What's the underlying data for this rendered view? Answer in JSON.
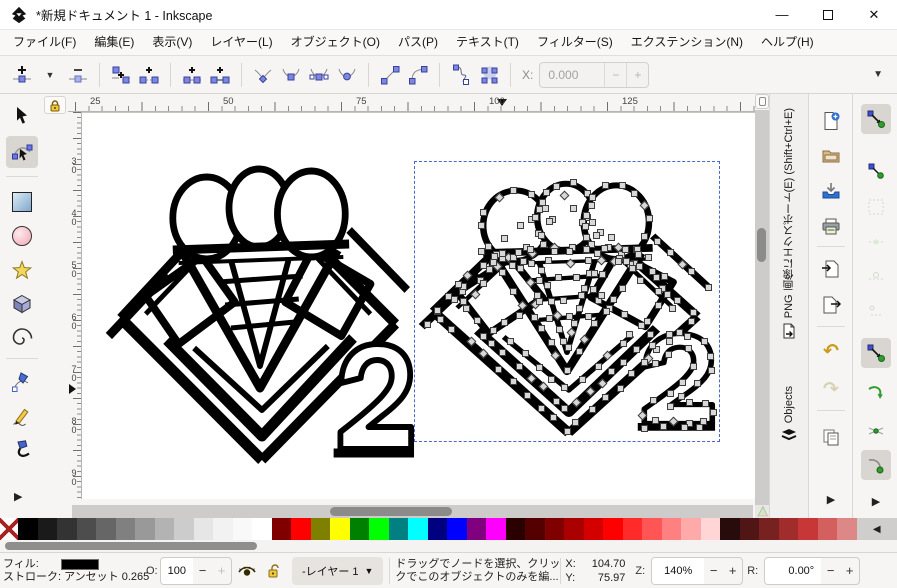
{
  "window": {
    "title": "*新規ドキュメント 1 - Inkscape",
    "minimize_glyph": "—",
    "close_glyph": "✕"
  },
  "menubar": {
    "items": [
      {
        "label": "ファイル(F)"
      },
      {
        "label": "編集(E)"
      },
      {
        "label": "表示(V)"
      },
      {
        "label": "レイヤー(L)"
      },
      {
        "label": "オブジェクト(O)"
      },
      {
        "label": "パス(P)"
      },
      {
        "label": "テキスト(T)"
      },
      {
        "label": "フィルター(S)"
      },
      {
        "label": "エクステンション(N)"
      },
      {
        "label": "ヘルプ(H)"
      }
    ]
  },
  "tool_options": {
    "icons": [
      "insert-node",
      "node-menu-dropdown",
      "delete-node",
      "break-node",
      "delete-segment",
      "join-nodes",
      "join-segment",
      "node-corner",
      "node-smooth",
      "node-symmetric",
      "node-auto",
      "segment-line",
      "segment-curve",
      "path-outline",
      "show-transform-handles"
    ],
    "x_label": "X:",
    "x_value": "0.000",
    "minus": "−",
    "plus": "+",
    "overflow_glyph": "▼"
  },
  "toolbox": {
    "tools": [
      "selector",
      "node-editor",
      "rectangle",
      "ellipse",
      "star",
      "box-3d",
      "spiral",
      "pen",
      "pencil",
      "calligraphy"
    ],
    "active_tool": "node-editor",
    "expander_glyph": "▶"
  },
  "rulers": {
    "horizontal_labels": [
      "25",
      "50",
      "75",
      "100",
      "125"
    ],
    "vertical_labels": [
      "30",
      "40",
      "50",
      "60",
      "70",
      "80",
      "90"
    ]
  },
  "dock_tabs": {
    "export_label": "PNG 画像にエクスポート(E) (Shift+Ctrl+E)",
    "objects_label": "Objects"
  },
  "commands_bar": {
    "icons": [
      "new-document",
      "open-document",
      "save-document",
      "print",
      "import",
      "export",
      "undo",
      "redo",
      "duplicate",
      "more"
    ],
    "undo_glyph": "↶",
    "redo_glyph": "↷",
    "expander_glyph": "▶"
  },
  "snap_bar": {
    "icons": [
      "snap-enabled",
      "snap-bounding-box",
      "snap-bbox-edges",
      "snap-bbox-corners",
      "snap-bbox-midpoints",
      "snap-bbox-centers",
      "snap-nodes",
      "snap-to-paths",
      "snap-path-intersections",
      "snap-smooth-nodes",
      "more"
    ],
    "expander_glyph": "▶"
  },
  "palette": {
    "prev_glyph": "◀",
    "colors": [
      "none",
      "#000000",
      "#1a1a1a",
      "#333333",
      "#4d4d4d",
      "#666666",
      "#808080",
      "#999999",
      "#b3b3b3",
      "#cccccc",
      "#e6e6e6",
      "#f2f2f2",
      "#f9f9f9",
      "#ffffff",
      "#800000",
      "#ff0000",
      "#808000",
      "#ffff00",
      "#008000",
      "#00ff00",
      "#008080",
      "#00ffff",
      "#000080",
      "#0000ff",
      "#800080",
      "#ff00ff",
      "#2b0000",
      "#550000",
      "#800000",
      "#aa0000",
      "#d40000",
      "#ff0000",
      "#ff2a2a",
      "#ff5555",
      "#ff8080",
      "#ffaaaa",
      "#ffd5d5",
      "#280b0b",
      "#501616",
      "#782121",
      "#a02c2c",
      "#c83737",
      "#d35f5f",
      "#de8787"
    ]
  },
  "statusbar": {
    "fill_label": "フィル:",
    "fill_value": "#000000",
    "stroke_label": "ストローク:",
    "stroke_paint": "アンセット",
    "stroke_width": "0.265",
    "opacity_label": "O:",
    "opacity_value": "100",
    "minus": "−",
    "plus": "+",
    "layer_label": "-レイヤー 1",
    "layer_caret": "▼",
    "message_line1": "ドラッグでノードを選択、クリッ",
    "message_line2": "クでこのオブジェクトのみを編...",
    "x_label": "X:",
    "x_value": "104.70",
    "y_label": "Y:",
    "y_value": "75.97",
    "zoom_label": "Z:",
    "zoom_value": "140%",
    "rotation_label": "R:",
    "rotation_value": "0.00°"
  },
  "colors": {
    "selection_dash": "#4a63d8",
    "node_handle_fill": "#d8d8d8",
    "chrome_bg": "#f6f5f3",
    "accent_node_blue": "#7b87e0",
    "snap_green": "#2f9e2f"
  }
}
